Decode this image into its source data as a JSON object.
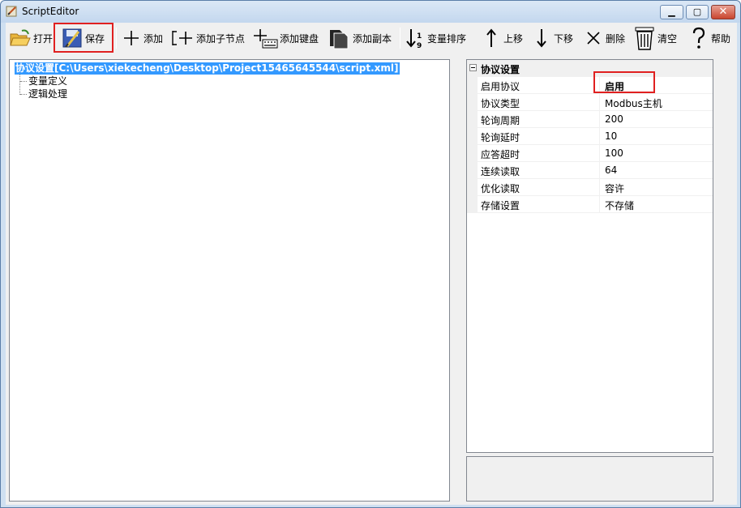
{
  "window": {
    "title": "ScriptEditor"
  },
  "toolbar": {
    "open_label": "打开",
    "save_label": "保存",
    "add_label": "添加",
    "add_child_label": "添加子节点",
    "add_keyboard_label": "添加键盘",
    "add_copy_label": "添加副本",
    "var_sort_label": "变量排序",
    "move_up_label": "上移",
    "move_down_label": "下移",
    "delete_label": "删除",
    "clear_label": "清空",
    "help_label": "帮助"
  },
  "tree": {
    "root_label": "协议设置[C:\\Users\\xiekecheng\\Desktop\\Project15465645544\\script.xml]",
    "children": [
      "变量定义",
      "逻辑处理"
    ]
  },
  "properties": {
    "category": "协议设置",
    "rows": [
      {
        "name": "启用协议",
        "value": "启用"
      },
      {
        "name": "协议类型",
        "value": "Modbus主机"
      },
      {
        "name": "轮询周期",
        "value": "200"
      },
      {
        "name": "轮询延时",
        "value": "10"
      },
      {
        "name": "应答超时",
        "value": "100"
      },
      {
        "name": "连续读取",
        "value": "64"
      },
      {
        "name": "优化读取",
        "value": "容许"
      },
      {
        "name": "存储设置",
        "value": "不存储"
      }
    ]
  },
  "colors": {
    "selection": "#3399ff",
    "highlight_box": "#e02020"
  }
}
